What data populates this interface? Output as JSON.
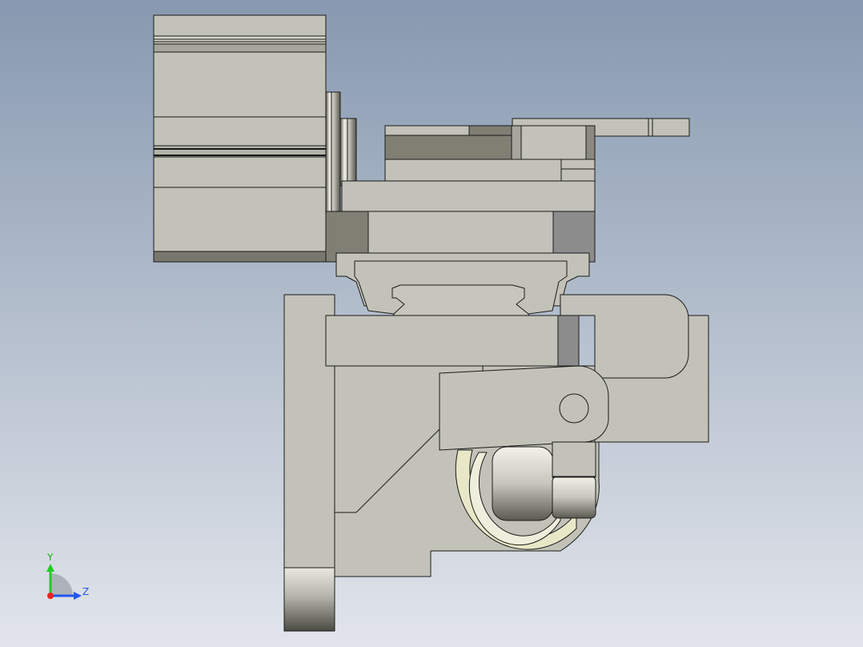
{
  "viewport": {
    "background_top": "#8a9ab0",
    "background_bottom": "#dfe3ea",
    "part_color": "#c2c2b8",
    "part_dark": "#7d7d72",
    "part_mid": "#a0a098",
    "edge_color": "#1a1a1a"
  },
  "triad": {
    "y_label": "Y",
    "z_label": "Z",
    "y_color": "#22cc22",
    "z_color": "#2255ee",
    "x_color": "#ee2222"
  }
}
